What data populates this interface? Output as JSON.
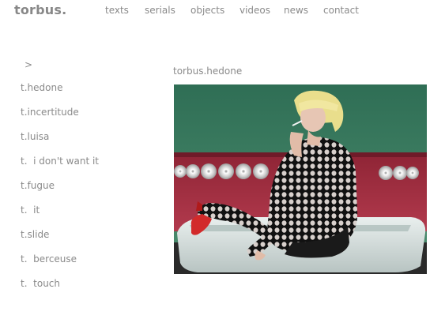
{
  "header": {
    "logo": "torbus.",
    "nav": [
      "texts",
      "serials",
      "objects",
      "videos",
      "news",
      "contact"
    ]
  },
  "sidebar": {
    "arrow": ">",
    "items": [
      "t.hedone",
      "t.incertitude",
      "t.luisa",
      "t.  i don't want it",
      "t.fugue",
      "t.  it",
      "t.slide",
      "t.  berceuse",
      "t.  touch"
    ]
  },
  "main": {
    "video_title": "torbus.hedone"
  },
  "colors": {
    "text": "#8a8a8a",
    "logo": "#888888",
    "background": "#ffffff"
  }
}
